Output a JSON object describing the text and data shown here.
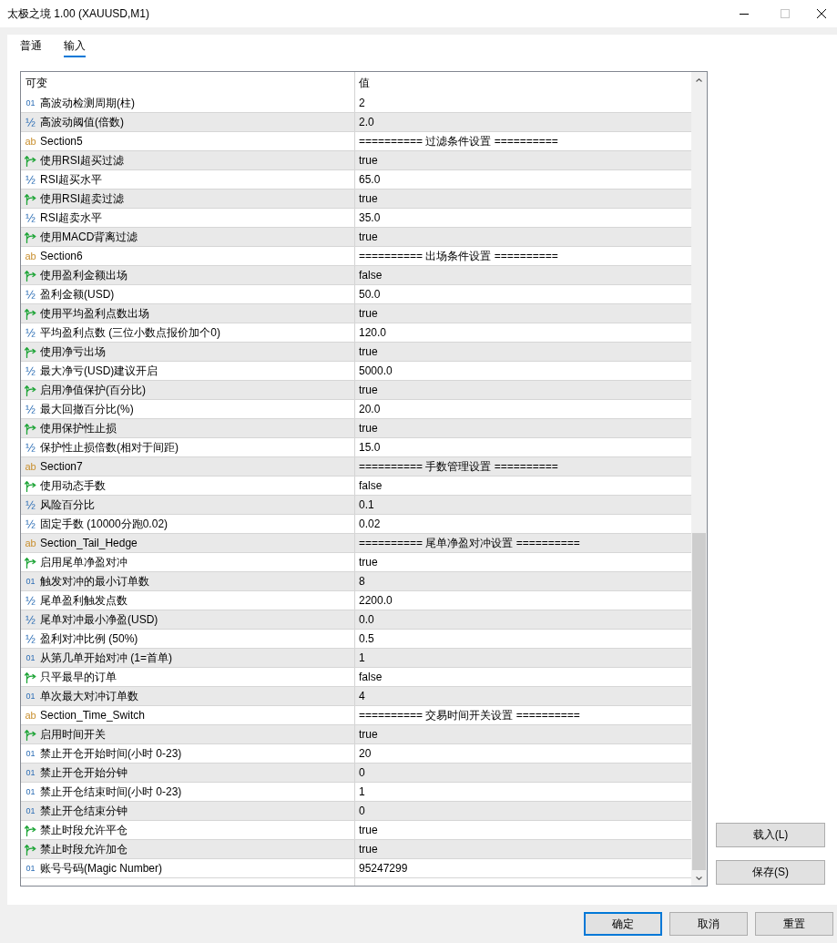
{
  "window": {
    "title": "太极之境 1.00 (XAUUSD,M1)",
    "maximize_disabled": true
  },
  "tabs": [
    {
      "label": "普通",
      "selected": false
    },
    {
      "label": "输入",
      "selected": true
    }
  ],
  "table": {
    "columns": [
      "可变",
      "值"
    ],
    "rows": [
      {
        "kind": "int",
        "icon": "01",
        "name": "高波动检测周期(柱)",
        "value": "2"
      },
      {
        "kind": "double",
        "icon": "½",
        "name": "高波动阈值(倍数)",
        "value": "2.0"
      },
      {
        "kind": "string",
        "icon": "ab",
        "name": "Section5",
        "value": "========== 过滤条件设置 =========="
      },
      {
        "kind": "bool",
        "name": "使用RSI超买过滤",
        "value": "true"
      },
      {
        "kind": "double",
        "icon": "½",
        "name": "RSI超买水平",
        "value": "65.0"
      },
      {
        "kind": "bool",
        "name": "使用RSI超卖过滤",
        "value": "true"
      },
      {
        "kind": "double",
        "icon": "½",
        "name": "RSI超卖水平",
        "value": "35.0"
      },
      {
        "kind": "bool",
        "name": "使用MACD背离过滤",
        "value": "true"
      },
      {
        "kind": "string",
        "icon": "ab",
        "name": "Section6",
        "value": "========== 出场条件设置 =========="
      },
      {
        "kind": "bool",
        "name": "使用盈利金额出场",
        "value": "false"
      },
      {
        "kind": "double",
        "icon": "½",
        "name": "盈利金额(USD)",
        "value": "50.0"
      },
      {
        "kind": "bool",
        "name": "使用平均盈利点数出场",
        "value": "true"
      },
      {
        "kind": "double",
        "icon": "½",
        "name": "平均盈利点数 (三位小数点报价加个0)",
        "value": "120.0"
      },
      {
        "kind": "bool",
        "name": "使用净亏出场",
        "value": "true"
      },
      {
        "kind": "double",
        "icon": "½",
        "name": "最大净亏(USD)建议开启",
        "value": "5000.0"
      },
      {
        "kind": "bool",
        "name": "启用净值保护(百分比)",
        "value": "true"
      },
      {
        "kind": "double",
        "icon": "½",
        "name": "最大回撤百分比(%)",
        "value": "20.0"
      },
      {
        "kind": "bool",
        "name": "使用保护性止损",
        "value": "true"
      },
      {
        "kind": "double",
        "icon": "½",
        "name": "保护性止损倍数(相对于间距)",
        "value": "15.0"
      },
      {
        "kind": "string",
        "icon": "ab",
        "name": "Section7",
        "value": "========== 手数管理设置 =========="
      },
      {
        "kind": "bool",
        "name": "使用动态手数",
        "value": "false"
      },
      {
        "kind": "double",
        "icon": "½",
        "name": "风险百分比",
        "value": "0.1"
      },
      {
        "kind": "double",
        "icon": "½",
        "name": "固定手数 (10000分跑0.02)",
        "value": "0.02"
      },
      {
        "kind": "string",
        "icon": "ab",
        "name": "Section_Tail_Hedge",
        "value": "========== 尾单净盈对冲设置 =========="
      },
      {
        "kind": "bool",
        "name": "启用尾单净盈对冲",
        "value": "true"
      },
      {
        "kind": "int",
        "icon": "01",
        "name": "触发对冲的最小订单数",
        "value": "8"
      },
      {
        "kind": "double",
        "icon": "½",
        "name": "尾单盈利触发点数",
        "value": "2200.0"
      },
      {
        "kind": "double",
        "icon": "½",
        "name": "尾单对冲最小净盈(USD)",
        "value": "0.0"
      },
      {
        "kind": "double",
        "icon": "½",
        "name": "盈利对冲比例 (50%)",
        "value": "0.5"
      },
      {
        "kind": "int",
        "icon": "01",
        "name": "从第几单开始对冲 (1=首单)",
        "value": "1"
      },
      {
        "kind": "bool",
        "name": "只平最早的订单",
        "value": "false"
      },
      {
        "kind": "int",
        "icon": "01",
        "name": "单次最大对冲订单数",
        "value": "4"
      },
      {
        "kind": "string",
        "icon": "ab",
        "name": "Section_Time_Switch",
        "value": "========== 交易时间开关设置 =========="
      },
      {
        "kind": "bool",
        "name": "启用时间开关",
        "value": "true"
      },
      {
        "kind": "int",
        "icon": "01",
        "name": "禁止开仓开始时间(小时 0-23)",
        "value": "20"
      },
      {
        "kind": "int",
        "icon": "01",
        "name": "禁止开仓开始分钟",
        "value": "0"
      },
      {
        "kind": "int",
        "icon": "01",
        "name": "禁止开仓结束时间(小时 0-23)",
        "value": "1"
      },
      {
        "kind": "int",
        "icon": "01",
        "name": "禁止开仓结束分钟",
        "value": "0"
      },
      {
        "kind": "bool",
        "name": "禁止时段允许平仓",
        "value": "true"
      },
      {
        "kind": "bool",
        "name": "禁止时段允许加仓",
        "value": "true"
      },
      {
        "kind": "int",
        "icon": "01",
        "name": "账号号码(Magic Number)",
        "value": "95247299"
      }
    ]
  },
  "side_buttons": [
    "载入(L)",
    "保存(S)"
  ],
  "buttons": [
    {
      "label": "确定",
      "default": true
    },
    {
      "label": "取消",
      "default": false
    },
    {
      "label": "重置",
      "default": false
    }
  ]
}
